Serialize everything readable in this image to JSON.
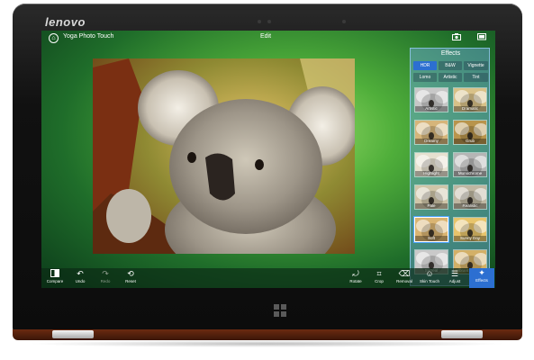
{
  "device": {
    "brand": "lenovo"
  },
  "header": {
    "app_title": "Yoga Photo Touch",
    "page_title": "Edit"
  },
  "effects_panel": {
    "title": "Effects",
    "tabs": [
      {
        "label": "HDR",
        "active": true
      },
      {
        "label": "B&W",
        "active": false
      },
      {
        "label": "Vignette",
        "active": false
      },
      {
        "label": "Lomo",
        "active": false
      },
      {
        "label": "Artistic",
        "active": false
      },
      {
        "label": "Tint",
        "active": false
      }
    ],
    "thumbnails": [
      {
        "label": "Artistic",
        "tone": "#c7c7c7"
      },
      {
        "label": "Dramatic",
        "tone": "#d8c188"
      },
      {
        "label": "Dreamy",
        "tone": "#d6b57a"
      },
      {
        "label": "Grub",
        "tone": "#b8944c"
      },
      {
        "label": "Highlight",
        "tone": "#e6e0cf"
      },
      {
        "label": "Monochrome",
        "tone": "#b5b5b5"
      },
      {
        "label": "Pale",
        "tone": "#cfc5a8"
      },
      {
        "label": "Realistic",
        "tone": "#bfb7a2"
      },
      {
        "label": "Soft",
        "tone": "#d9b472"
      },
      {
        "label": "Sunny Day",
        "tone": "#e7c46b"
      },
      {
        "label": "Surreal",
        "tone": "#c9c9c9"
      },
      {
        "label": "Vibrant Scenery",
        "tone": "#d3b067"
      }
    ]
  },
  "bottom_bar": {
    "compare": "Compare",
    "undo": "Undo",
    "redo": "Redo",
    "reset": "Reset",
    "rotate": "Rotate",
    "crop": "Crop",
    "removal": "Removal",
    "skin_touch": "Skin Touch",
    "adjust": "Adjust",
    "effects": "Effects"
  },
  "colors": {
    "accent": "#2c6fd1",
    "hinge": "#6b2a10"
  }
}
